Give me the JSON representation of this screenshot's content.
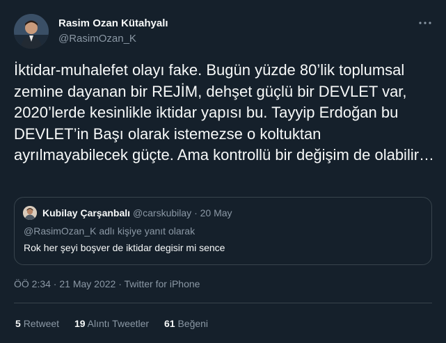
{
  "author": {
    "display_name": "Rasim Ozan Kütahyalı",
    "handle": "@RasimOzan_K"
  },
  "more_icon": "ellipsis-icon",
  "tweet_text": "İktidar-muhalefet olayı fake. Bugün yüzde 80’lik toplumsal zemine dayanan bir REJİM, dehşet güçlü bir DEVLET var, 2020’lerde kesinlikle iktidar yapısı bu. Tayyip Erdoğan bu DEVLET’in Başı olarak istemezse o koltuktan ayrılmayabilecek güçte. Ama kontrollü bir değişim de olabilir…",
  "quoted": {
    "display_name": "Kubilay Çarşanbalı",
    "handle": "@carskubilay",
    "date": "· 20 May",
    "reply_context": "@RasimOzan_K adlı kişiye yanıt olarak",
    "text": "Rok her şeyi boşver de iktidar degisir mi sence"
  },
  "timestamp": "ÖÖ 2:34 · 21 May 2022 · Twitter for iPhone",
  "stats": {
    "retweets_count": "5",
    "retweets_label": "Retweet",
    "quotes_count": "19",
    "quotes_label": "Alıntı Tweetler",
    "likes_count": "61",
    "likes_label": "Beğeni"
  },
  "colors": {
    "background": "#15202b",
    "text": "#f7f9f9",
    "secondary": "#8b98a5",
    "border": "#38444d"
  }
}
